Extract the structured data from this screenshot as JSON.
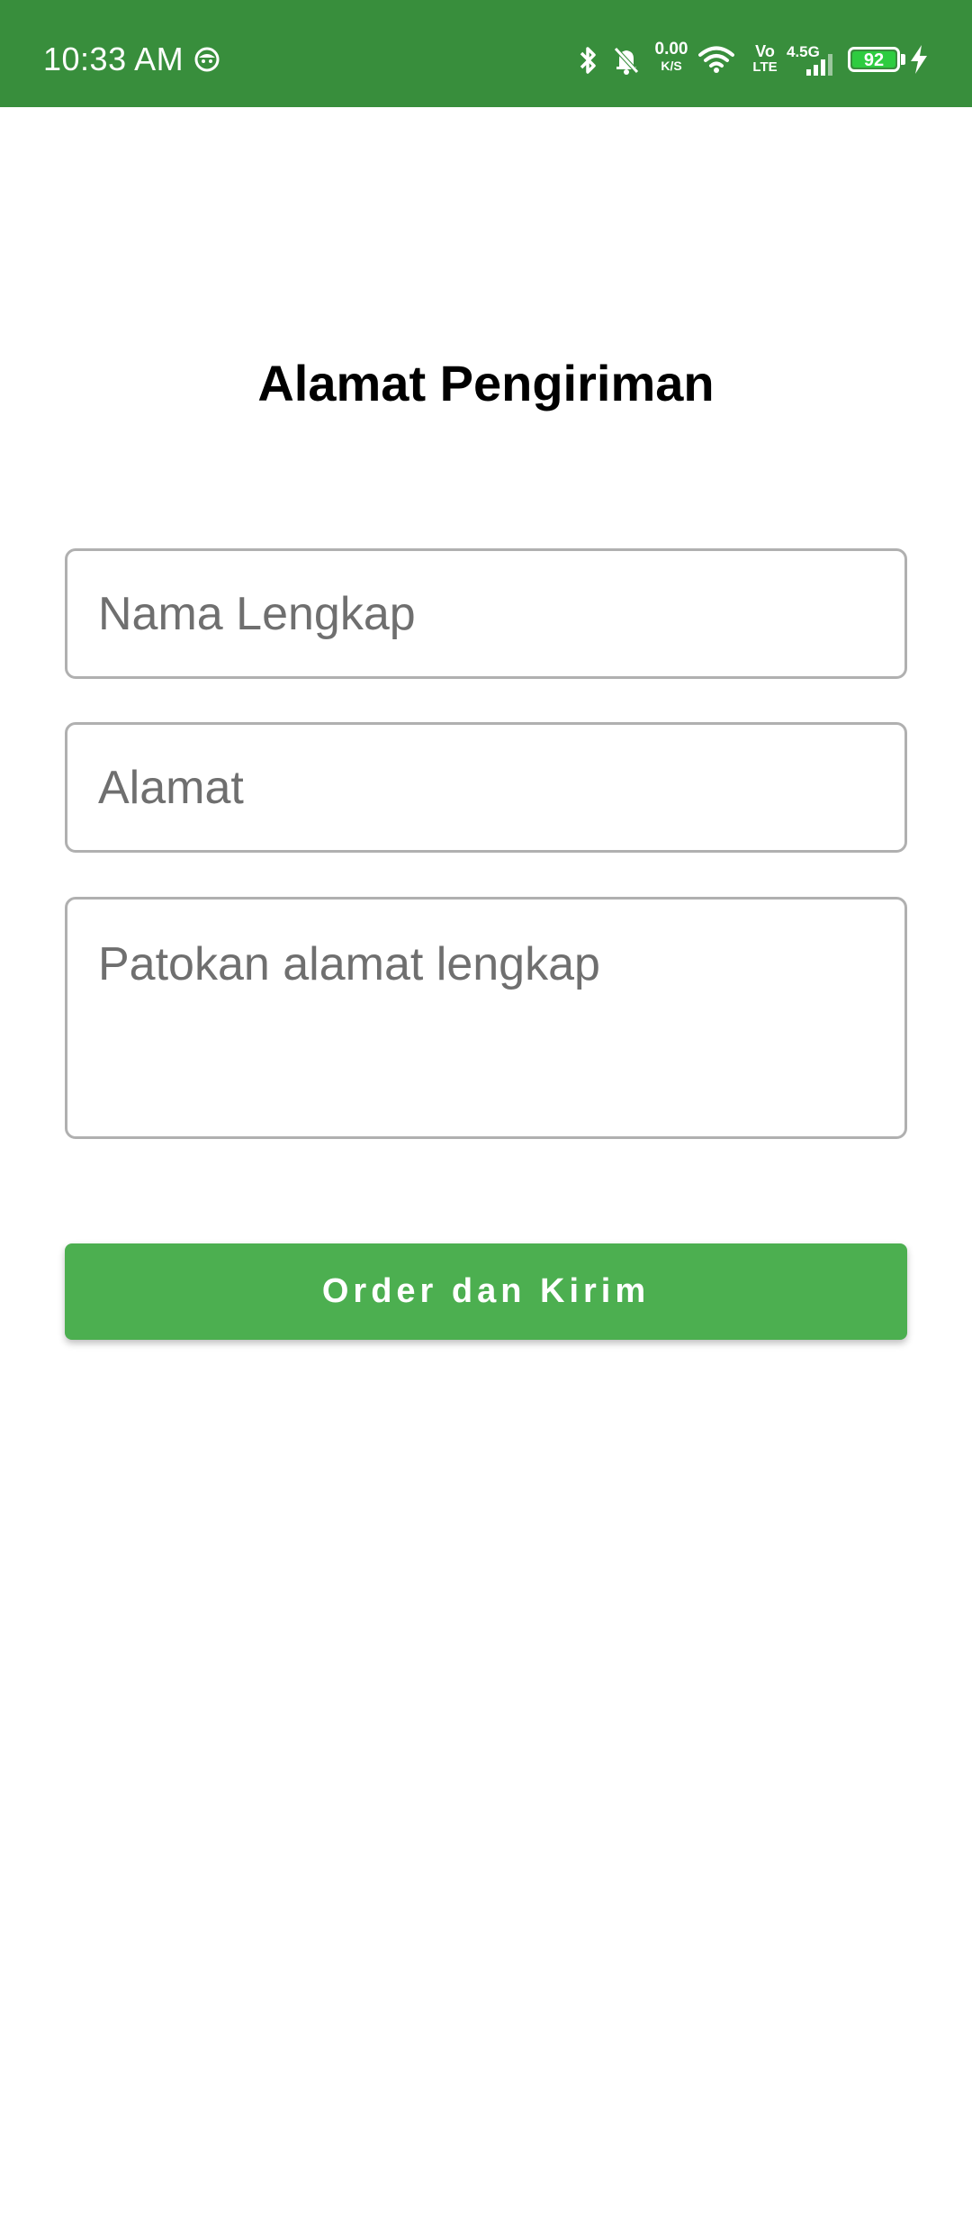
{
  "status_bar": {
    "time": "10:33 AM",
    "net_speed_value": "0.00",
    "net_speed_unit": "K/S",
    "volte_top": "Vo",
    "volte_bottom": "LTE",
    "network_gen": "4.5G",
    "battery": "92",
    "background": "#388e3c"
  },
  "page": {
    "title": "Alamat Pengiriman"
  },
  "form": {
    "name_placeholder": "Nama Lengkap",
    "address_placeholder": "Alamat",
    "landmark_placeholder": "Patokan alamat lengkap",
    "submit_label": "Order dan Kirim",
    "accent": "#4caf50"
  },
  "icons": {
    "status_face": "face-icon",
    "bluetooth": "bluetooth-icon",
    "mute": "bell-off-icon",
    "wifi": "wifi-icon",
    "signal": "signal-icon",
    "charging": "charging-bolt-icon"
  }
}
